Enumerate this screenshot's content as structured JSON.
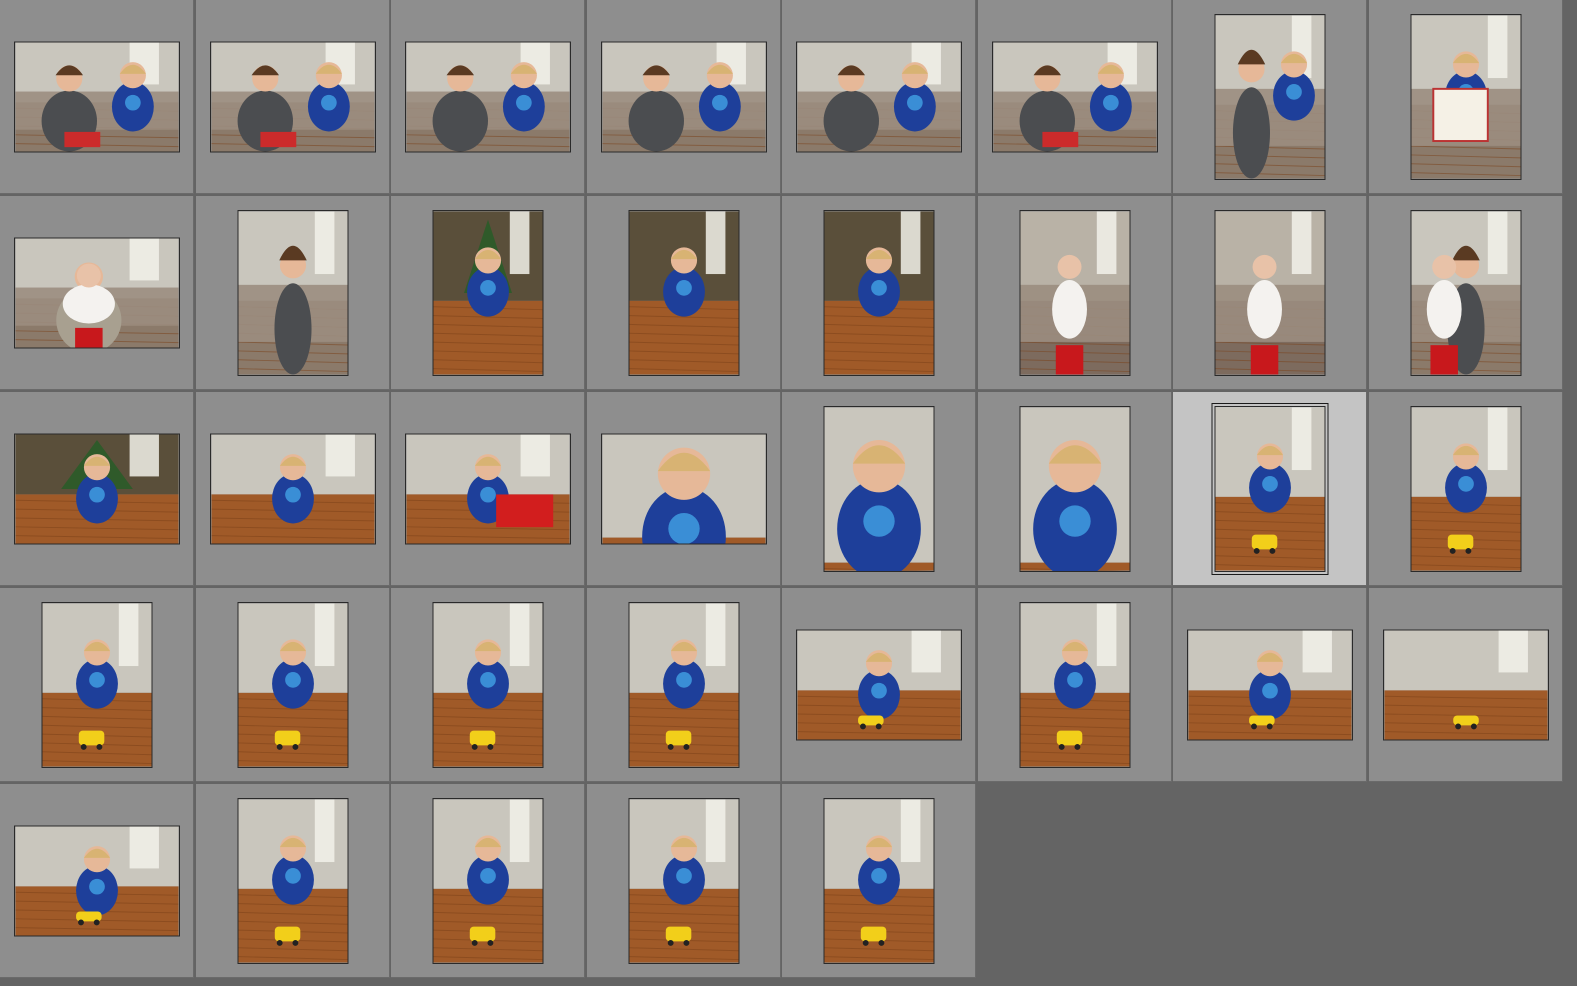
{
  "view": "grid",
  "selected_index": 22,
  "thumbnails": [
    {
      "orientation": "landscape",
      "scene": "woman-and-boy-on-sofa-with-gift"
    },
    {
      "orientation": "landscape",
      "scene": "woman-and-boy-on-sofa-with-gift"
    },
    {
      "orientation": "landscape",
      "scene": "woman-holding-dark-garment-boy"
    },
    {
      "orientation": "landscape",
      "scene": "woman-holding-dark-garment-boy"
    },
    {
      "orientation": "landscape",
      "scene": "woman-holding-toy-boy"
    },
    {
      "orientation": "landscape",
      "scene": "woman-and-boy-unwrapping-gift"
    },
    {
      "orientation": "portrait",
      "scene": "woman-and-boy-on-sofa"
    },
    {
      "orientation": "portrait",
      "scene": "boy-holding-book-on-sofa"
    },
    {
      "orientation": "landscape",
      "scene": "man-holding-baby"
    },
    {
      "orientation": "portrait",
      "scene": "woman-holding-phone"
    },
    {
      "orientation": "portrait",
      "scene": "boy-on-floor-by-tree"
    },
    {
      "orientation": "portrait",
      "scene": "boy-sitting-with-toy"
    },
    {
      "orientation": "portrait",
      "scene": "boy-lying-on-floor"
    },
    {
      "orientation": "portrait",
      "scene": "baby-in-lap"
    },
    {
      "orientation": "portrait",
      "scene": "baby-in-arms"
    },
    {
      "orientation": "portrait",
      "scene": "woman-holding-baby"
    },
    {
      "orientation": "landscape",
      "scene": "boy-by-christmas-tree"
    },
    {
      "orientation": "landscape",
      "scene": "boy-head-on-floor-with-truck"
    },
    {
      "orientation": "landscape",
      "scene": "boy-with-red-toy-garage"
    },
    {
      "orientation": "landscape",
      "scene": "boy-closeup-looking-down"
    },
    {
      "orientation": "portrait",
      "scene": "boy-smiling-closeup"
    },
    {
      "orientation": "portrait",
      "scene": "boy-laughing-closeup"
    },
    {
      "orientation": "portrait",
      "scene": "boy-with-yellow-car-on-floor"
    },
    {
      "orientation": "portrait",
      "scene": "boy-with-yellow-car-on-floor"
    },
    {
      "orientation": "portrait",
      "scene": "boy-with-yellow-car-on-floor"
    },
    {
      "orientation": "portrait",
      "scene": "boy-with-yellow-car-on-floor"
    },
    {
      "orientation": "portrait",
      "scene": "boy-with-yellow-car-on-floor"
    },
    {
      "orientation": "portrait",
      "scene": "boy-with-yellow-car-on-floor"
    },
    {
      "orientation": "landscape",
      "scene": "boy-with-yellow-car-on-floor"
    },
    {
      "orientation": "portrait",
      "scene": "boy-with-yellow-car-on-floor"
    },
    {
      "orientation": "landscape",
      "scene": "boy-crawling-with-car"
    },
    {
      "orientation": "landscape",
      "scene": "yellow-car-on-floor"
    },
    {
      "orientation": "landscape",
      "scene": "boy-holding-yellow-car"
    },
    {
      "orientation": "portrait",
      "scene": "boy-with-yellow-car-on-floor"
    },
    {
      "orientation": "portrait",
      "scene": "boy-with-yellow-car-on-floor"
    },
    {
      "orientation": "portrait",
      "scene": "boy-with-yellow-car-on-floor"
    },
    {
      "orientation": "portrait",
      "scene": "boy-with-yellow-car-on-floor"
    }
  ],
  "colors": {
    "background": "#646464",
    "cell": "#8e8e8e",
    "cell_selected": "#c4c4c4",
    "pajama_blue": "#1e3f9a",
    "hair_blond": "#d8b373",
    "skin": "#e6b898",
    "floor_wood": "#a05a28",
    "wall": "#c9c6bd",
    "toy_yellow": "#f2cf1a"
  }
}
